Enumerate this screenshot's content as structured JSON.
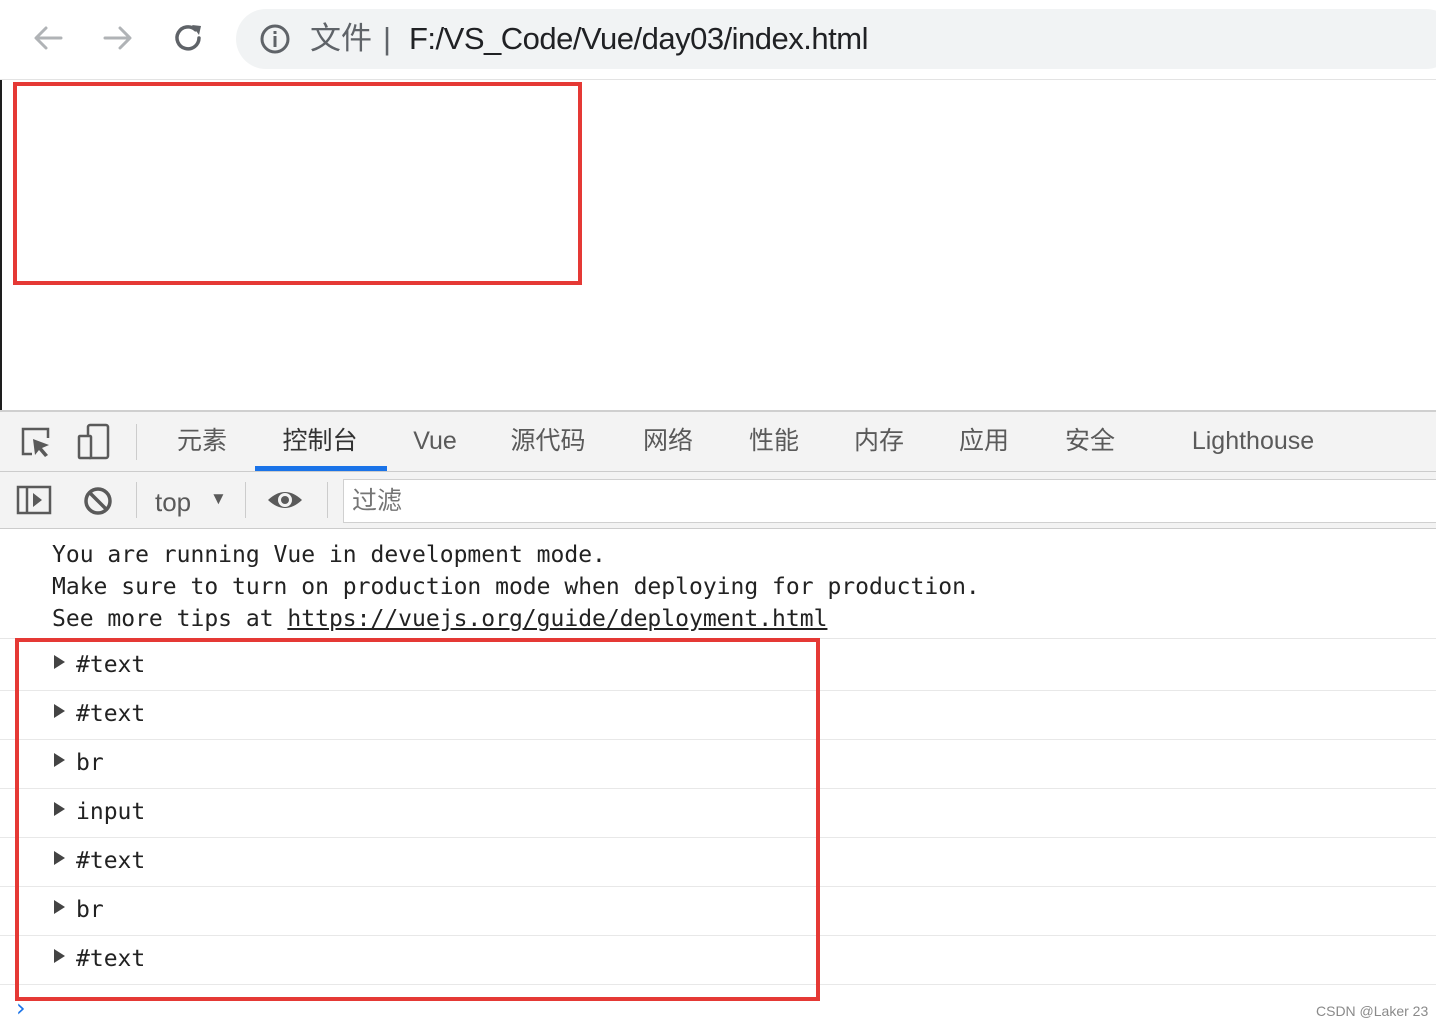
{
  "browser": {
    "back_icon": "arrow-left-icon",
    "forward_icon": "arrow-right-icon",
    "reload_icon": "reload-icon",
    "info_icon": "info-icon",
    "address_scheme": "文件",
    "address_separator": "|",
    "address_url": "F:/VS_Code/Vue/day03/index.html"
  },
  "devtools": {
    "tabs": [
      {
        "label": "元素"
      },
      {
        "label": "控制台",
        "active": true
      },
      {
        "label": "Vue"
      },
      {
        "label": "源代码"
      },
      {
        "label": "网络"
      },
      {
        "label": "性能"
      },
      {
        "label": "内存"
      },
      {
        "label": "应用"
      },
      {
        "label": "安全"
      },
      {
        "label": "Lighthouse"
      }
    ],
    "toolbar": {
      "context": "top",
      "context_arrow": "▼",
      "filter_placeholder": "过滤"
    }
  },
  "console": {
    "vue_message": {
      "line1": "You are running Vue in development mode.",
      "line2": "Make sure to turn on production mode when deploying for production.",
      "line3_prefix": "See more tips at ",
      "line3_link": "https://vuejs.org/guide/deployment.html"
    },
    "nodes": [
      "#text",
      "#text",
      "br",
      "input",
      "#text",
      "br",
      "#text"
    ],
    "prompt": "›"
  },
  "watermark": "CSDN @Laker 23",
  "colors": {
    "highlight_box": "#e53935",
    "active_tab_underline": "#1a73e8"
  }
}
